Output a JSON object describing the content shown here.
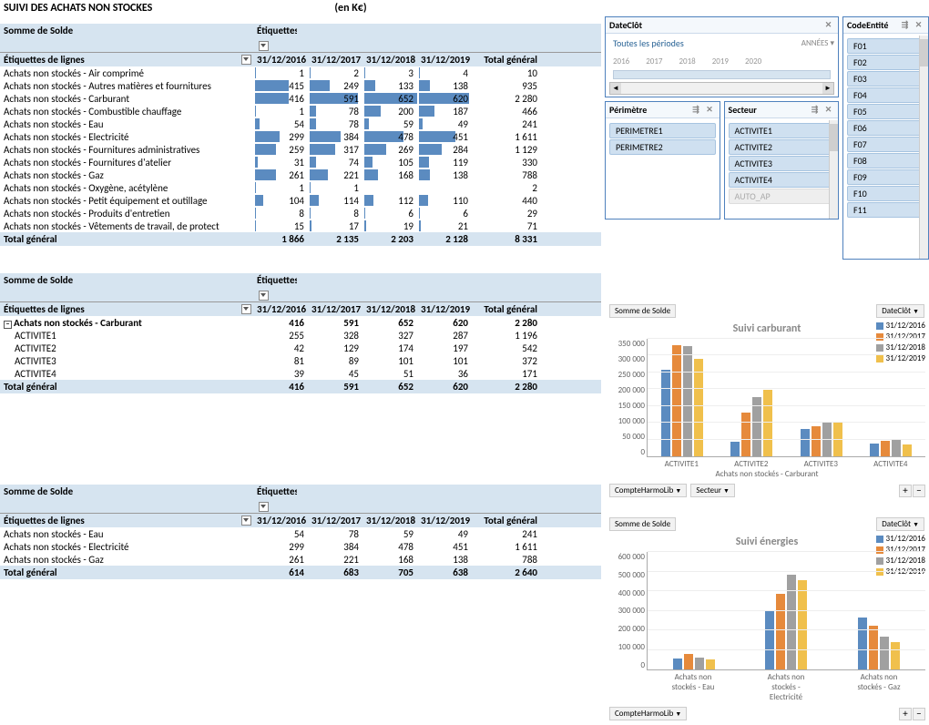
{
  "title": "SUIVI DES ACHATS NON STOCKES",
  "unit": "(en K€)",
  "pivot_labels": {
    "measure": "Somme de Solde",
    "cols": "Étiquettes",
    "rows": "Étiquettes de lignes",
    "total": "Total général"
  },
  "years": [
    "31/12/2016",
    "31/12/2017",
    "31/12/2018",
    "31/12/2019"
  ],
  "pivot1": {
    "rows": [
      {
        "l": "Achats non stockés - Air comprimé",
        "v": [
          1,
          2,
          3,
          4
        ],
        "t": 10
      },
      {
        "l": "Achats non stockés - Autres matières et fournitures",
        "v": [
          415,
          249,
          133,
          138
        ],
        "t": 935
      },
      {
        "l": "Achats non stockés - Carburant",
        "v": [
          416,
          591,
          652,
          620
        ],
        "t": 2280
      },
      {
        "l": "Achats non stockés - Combustible chauffage",
        "v": [
          1,
          78,
          200,
          187
        ],
        "t": 466
      },
      {
        "l": "Achats non stockés - Eau",
        "v": [
          54,
          78,
          59,
          49
        ],
        "t": 241
      },
      {
        "l": "Achats non stockés - Electricité",
        "v": [
          299,
          384,
          478,
          451
        ],
        "t": 1611
      },
      {
        "l": "Achats non stockés - Fournitures administratives",
        "v": [
          259,
          317,
          269,
          284
        ],
        "t": 1129
      },
      {
        "l": "Achats non stockés - Fournitures d'atelier",
        "v": [
          31,
          74,
          105,
          119
        ],
        "t": 330
      },
      {
        "l": "Achats non stockés - Gaz",
        "v": [
          261,
          221,
          168,
          138
        ],
        "t": 788
      },
      {
        "l": "Achats non stockés - Oxygène, acétylène",
        "v": [
          1,
          1,
          null,
          null
        ],
        "t": 2
      },
      {
        "l": "Achats non stockés - Petit équipement et outillage",
        "v": [
          104,
          114,
          112,
          110
        ],
        "t": 440
      },
      {
        "l": "Achats non stockés - Produits d'entretien",
        "v": [
          8,
          8,
          6,
          6
        ],
        "t": 29
      },
      {
        "l": "Achats non stockés - Vêtements de travail, de protect",
        "v": [
          15,
          17,
          19,
          21
        ],
        "t": 71
      }
    ],
    "total": {
      "v": [
        1866,
        2135,
        2203,
        2128
      ],
      "t": 8331
    },
    "max": 652
  },
  "pivot2": {
    "head": "Achats non stockés - Carburant",
    "headv": [
      416,
      591,
      652,
      620
    ],
    "headt": 2280,
    "rows": [
      {
        "l": "ACTIVITE1",
        "v": [
          255,
          328,
          327,
          287
        ],
        "t": 1196
      },
      {
        "l": "ACTIVITE2",
        "v": [
          42,
          129,
          174,
          197
        ],
        "t": 542
      },
      {
        "l": "ACTIVITE3",
        "v": [
          81,
          89,
          101,
          101
        ],
        "t": 372
      },
      {
        "l": "ACTIVITE4",
        "v": [
          39,
          45,
          51,
          36
        ],
        "t": 171
      }
    ],
    "total": {
      "v": [
        416,
        591,
        652,
        620
      ],
      "t": 2280
    }
  },
  "pivot3": {
    "rows": [
      {
        "l": "Achats non stockés - Eau",
        "v": [
          54,
          78,
          59,
          49
        ],
        "t": 241
      },
      {
        "l": "Achats non stockés - Electricité",
        "v": [
          299,
          384,
          478,
          451
        ],
        "t": 1611
      },
      {
        "l": "Achats non stockés - Gaz",
        "v": [
          261,
          221,
          168,
          138
        ],
        "t": 788
      }
    ],
    "total": {
      "v": [
        614,
        683,
        705,
        638
      ],
      "t": 2640
    }
  },
  "slicers": {
    "date": {
      "title": "DateClôt",
      "link": "Toutes les périodes",
      "unit": "ANNÉES",
      "ticks": [
        "2016",
        "2017",
        "2018",
        "2019",
        "2020"
      ]
    },
    "perimetre": {
      "title": "Périmètre",
      "items": [
        "PERIMETRE1",
        "PERIMETRE2"
      ]
    },
    "secteur": {
      "title": "Secteur",
      "items": [
        "ACTIVITE1",
        "ACTIVITE2",
        "ACTIVITE3",
        "ACTIVITE4",
        "AUTO_AP"
      ]
    },
    "code": {
      "title": "CodeEntité",
      "items": [
        "F01",
        "F02",
        "F03",
        "F04",
        "F05",
        "F06",
        "F07",
        "F08",
        "F09",
        "F10",
        "F11"
      ]
    }
  },
  "chart1": {
    "btn_measure": "Somme de Solde",
    "btn_dd": "DateClôt",
    "title": "Suivi carburant",
    "yticks": [
      "350 000",
      "300 000",
      "250 000",
      "200 000",
      "150 000",
      "100 000",
      "50 000",
      "0"
    ],
    "ymax": 350000,
    "cats": [
      "ACTIVITE1",
      "ACTIVITE2",
      "ACTIVITE3",
      "ACTIVITE4"
    ],
    "xlabel": "Achats non stockés - Carburant",
    "series": [
      {
        "n": "31/12/2016",
        "v": [
          255000,
          42000,
          81000,
          39000
        ]
      },
      {
        "n": "31/12/2017",
        "v": [
          328000,
          129000,
          89000,
          45000
        ]
      },
      {
        "n": "31/12/2018",
        "v": [
          327000,
          174000,
          101000,
          51000
        ]
      },
      {
        "n": "31/12/2019",
        "v": [
          287000,
          197000,
          101000,
          36000
        ]
      }
    ],
    "bot": [
      "CompteHarmoLib",
      "Secteur"
    ]
  },
  "chart2": {
    "btn_measure": "Somme de Solde",
    "btn_dd": "DateClôt",
    "title": "Suivi énergies",
    "yticks": [
      "600 000",
      "500 000",
      "400 000",
      "300 000",
      "200 000",
      "100 000",
      "0"
    ],
    "ymax": 600000,
    "cats": [
      "Achats non stockés - Eau",
      "Achats non stockés - Electricité",
      "Achats non stockés - Gaz"
    ],
    "series": [
      {
        "n": "31/12/2016",
        "v": [
          54000,
          299000,
          261000
        ]
      },
      {
        "n": "31/12/2017",
        "v": [
          78000,
          384000,
          221000
        ]
      },
      {
        "n": "31/12/2018",
        "v": [
          59000,
          478000,
          168000
        ]
      },
      {
        "n": "31/12/2019",
        "v": [
          49000,
          451000,
          138000
        ]
      }
    ],
    "bot": [
      "CompteHarmoLib"
    ]
  },
  "chart_data": [
    {
      "type": "bar",
      "title": "Suivi carburant",
      "xlabel": "Achats non stockés - Carburant",
      "ylabel": "",
      "ylim": [
        0,
        350000
      ],
      "categories": [
        "ACTIVITE1",
        "ACTIVITE2",
        "ACTIVITE3",
        "ACTIVITE4"
      ],
      "series": [
        {
          "name": "31/12/2016",
          "values": [
            255000,
            42000,
            81000,
            39000
          ]
        },
        {
          "name": "31/12/2017",
          "values": [
            328000,
            129000,
            89000,
            45000
          ]
        },
        {
          "name": "31/12/2018",
          "values": [
            327000,
            174000,
            101000,
            51000
          ]
        },
        {
          "name": "31/12/2019",
          "values": [
            287000,
            197000,
            101000,
            36000
          ]
        }
      ]
    },
    {
      "type": "bar",
      "title": "Suivi énergies",
      "xlabel": "",
      "ylabel": "",
      "ylim": [
        0,
        600000
      ],
      "categories": [
        "Achats non stockés - Eau",
        "Achats non stockés - Electricité",
        "Achats non stockés - Gaz"
      ],
      "series": [
        {
          "name": "31/12/2016",
          "values": [
            54000,
            299000,
            261000
          ]
        },
        {
          "name": "31/12/2017",
          "values": [
            78000,
            384000,
            221000
          ]
        },
        {
          "name": "31/12/2018",
          "values": [
            59000,
            478000,
            168000
          ]
        },
        {
          "name": "31/12/2019",
          "values": [
            49000,
            451000,
            138000
          ]
        }
      ]
    }
  ]
}
